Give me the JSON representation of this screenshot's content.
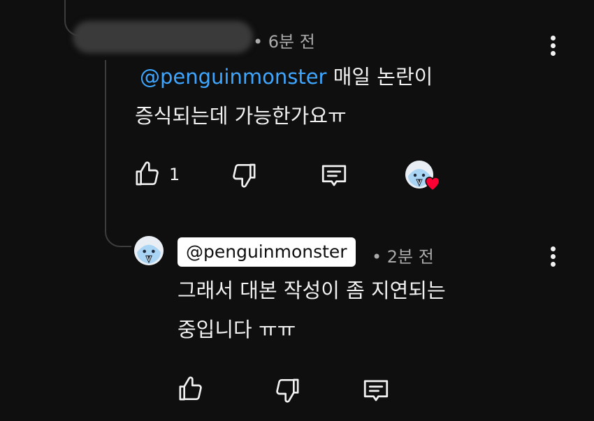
{
  "comment": {
    "timestamp": "• 6분 전",
    "mention": "@penguinmonster",
    "text_line1_rest": " 매일 논란이",
    "text_line2": "증식되는데 가능한가요ㅠ",
    "like_count": "1",
    "icons": {
      "like": "thumbs-up-icon",
      "dislike": "thumbs-down-icon",
      "reply": "reply-comment-icon",
      "creator_heart": "creator-heart-badge"
    }
  },
  "reply": {
    "author_chip": "@penguinmonster",
    "timestamp": "• 2분 전",
    "text_line1": "그래서 대본 작성이 좀 지연되는",
    "text_line2": "중입니다 ㅠㅠ",
    "icons": {
      "like": "thumbs-up-icon",
      "dislike": "thumbs-down-icon",
      "reply": "reply-comment-icon"
    }
  },
  "colors": {
    "background": "#0f0f0f",
    "mention": "#3ea6ff",
    "heart": "#ff0033",
    "meta": "#aaaaaa"
  }
}
